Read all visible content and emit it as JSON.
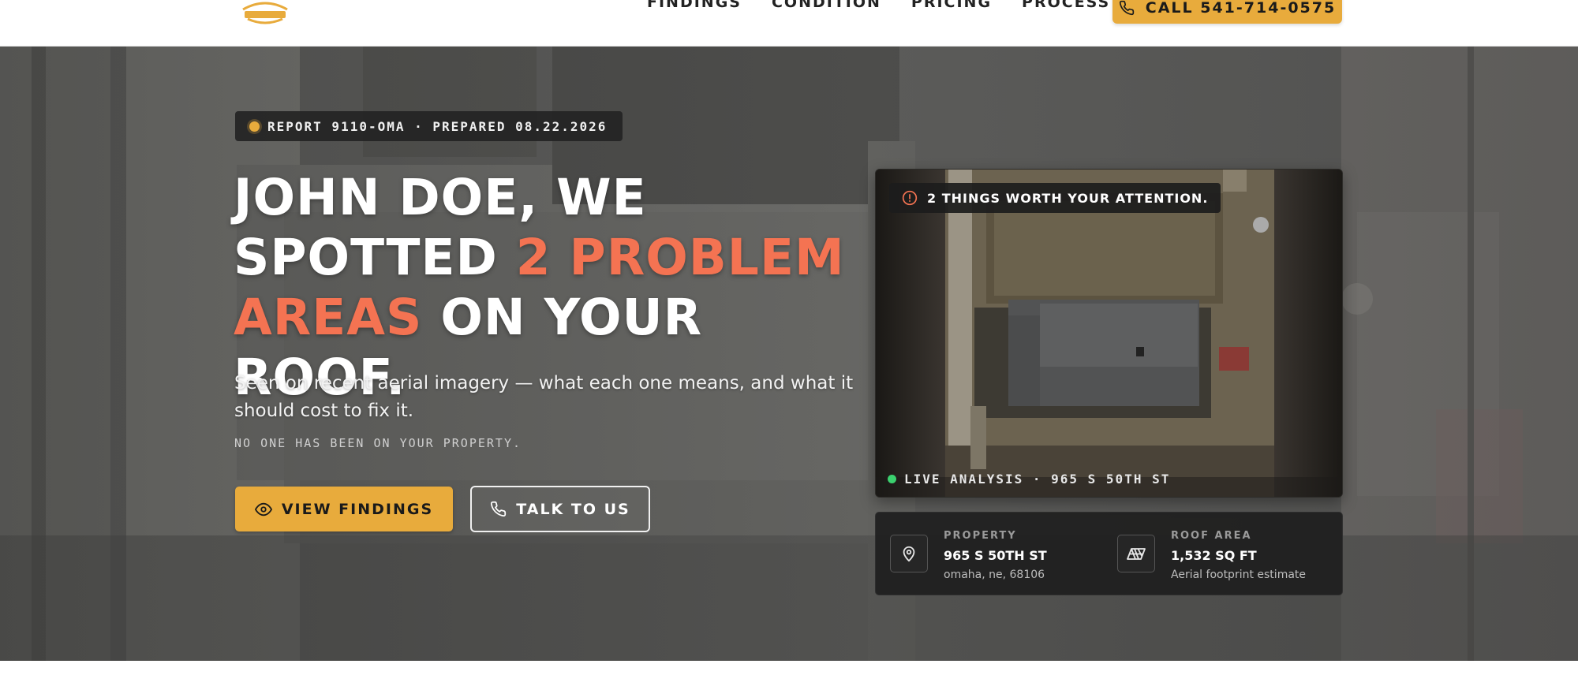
{
  "nav": {
    "items": [
      "FINDINGS",
      "CONDITION",
      "PRICING",
      "PROCESS"
    ],
    "call_label": "CALL 541-714-0575"
  },
  "hero": {
    "report_badge": "REPORT 9110-OMA · PREPARED 08.22.2026",
    "headline": {
      "part1": "JOHN DOE, WE SPOTTED ",
      "highlight": "2 PROBLEM AREAS",
      "part2": " ON YOUR ROOF."
    },
    "subtitle": "Seen on recent aerial imagery — what each one means, and what it should cost to fix it.",
    "note": "NO ONE HAS BEEN ON YOUR PROPERTY.",
    "primary_button": "VIEW FINDINGS",
    "secondary_button": "TALK TO US"
  },
  "image_card": {
    "attention": "2 THINGS WORTH YOUR ATTENTION.",
    "live_label": "LIVE ANALYSIS · 965 S 50TH ST"
  },
  "info": {
    "property": {
      "label": "PROPERTY",
      "value": "965 S 50TH ST",
      "sub": "omaha, ne, 68106"
    },
    "roof_area": {
      "label": "ROOF AREA",
      "value": "1,532 SQ FT",
      "sub": "Aerial footprint estimate"
    }
  },
  "colors": {
    "accent": "#e8ab3c",
    "highlight": "#f47352",
    "live": "#3bd16f"
  }
}
